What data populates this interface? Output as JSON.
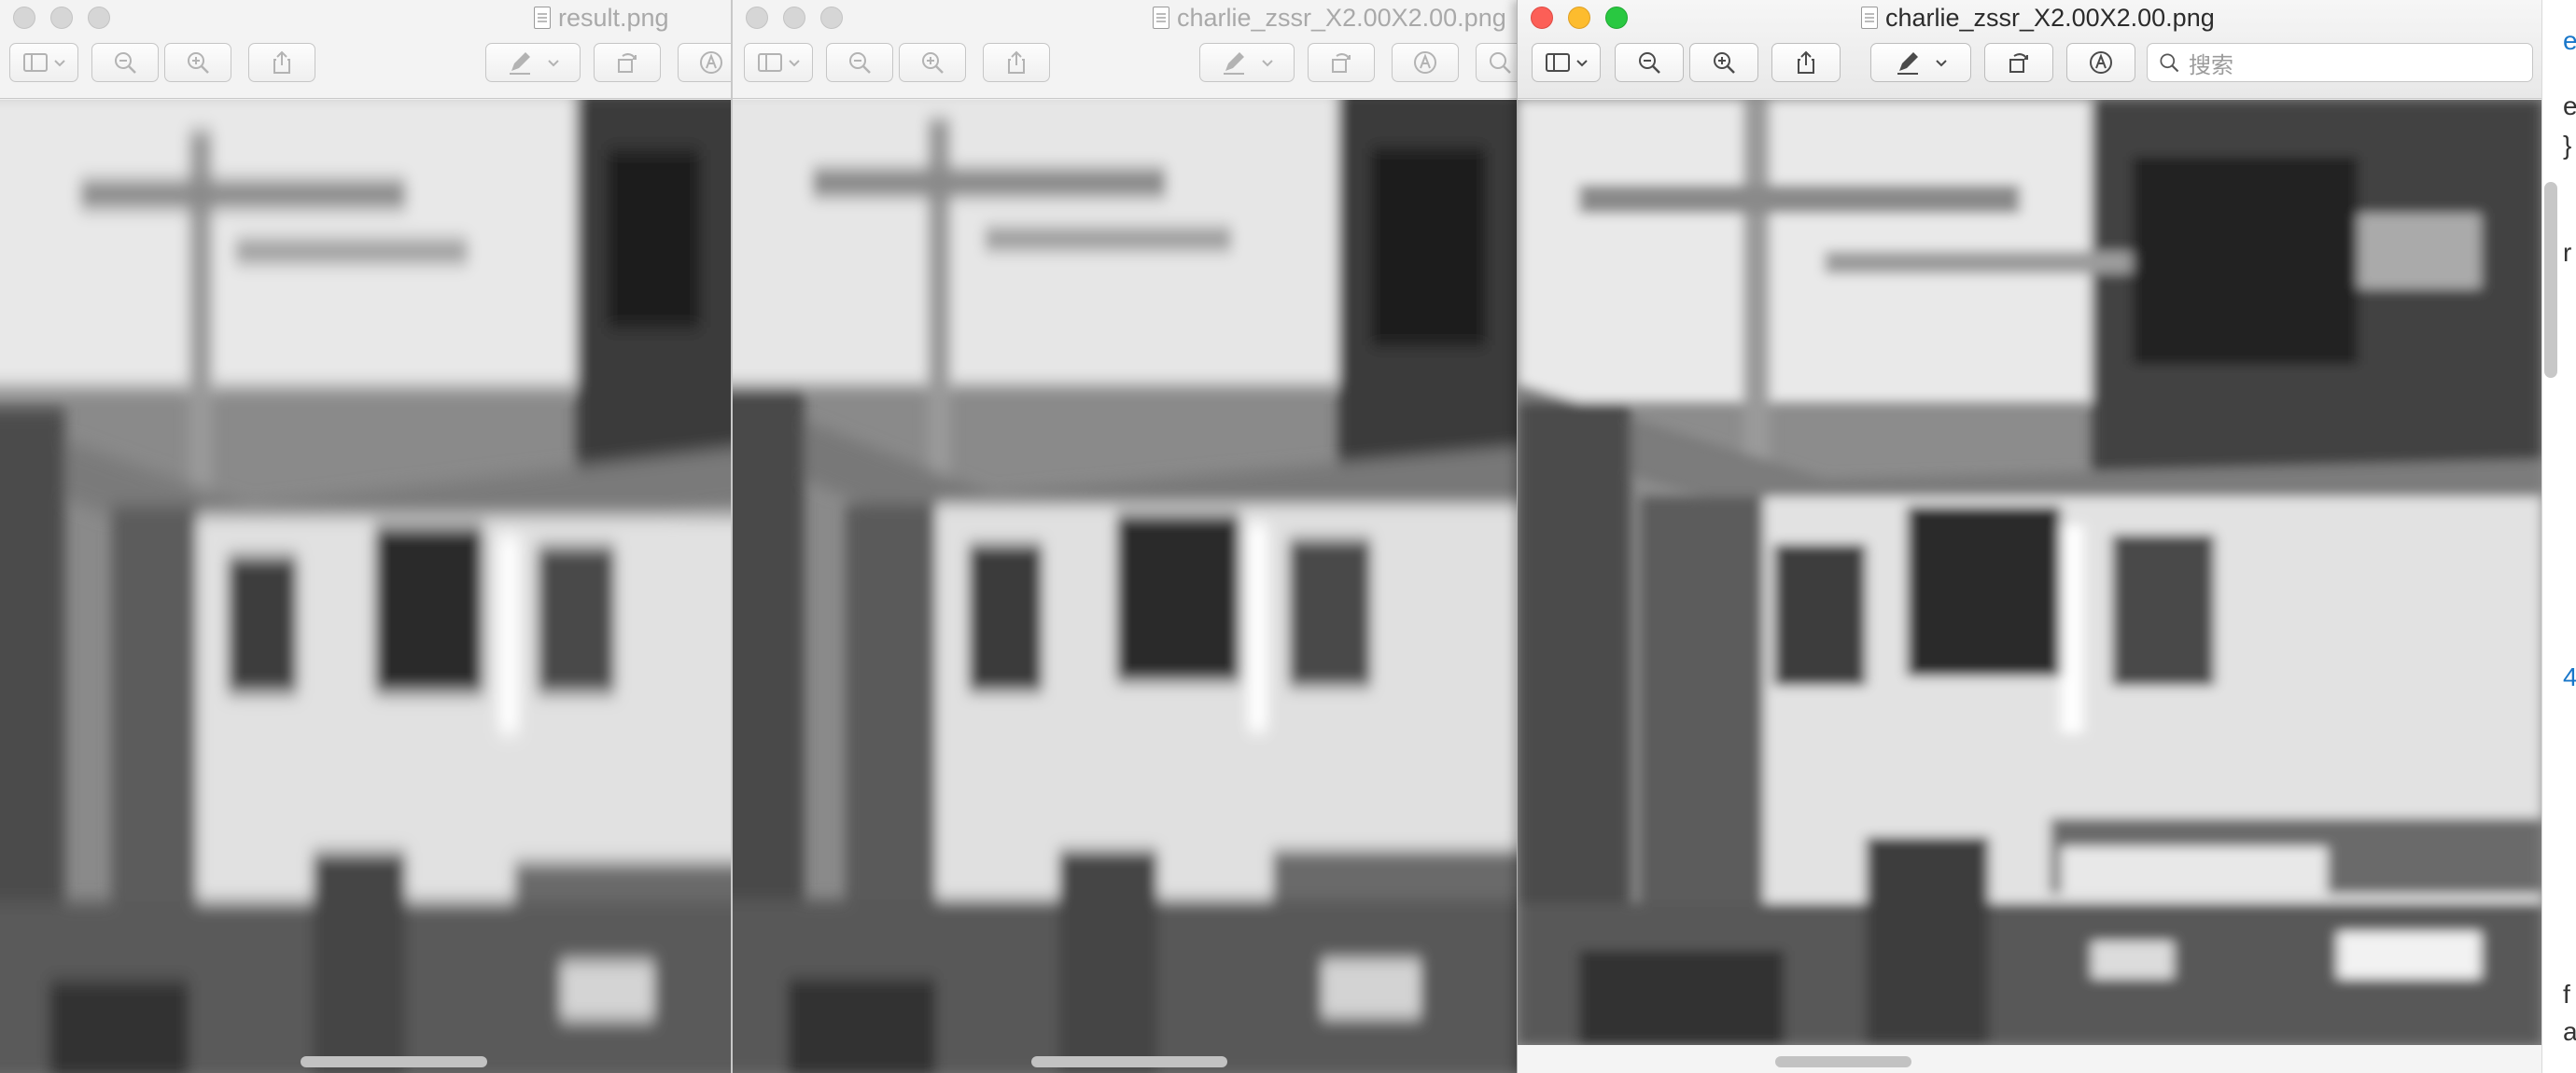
{
  "windows": [
    {
      "id": "left",
      "title": "result.png",
      "active": false
    },
    {
      "id": "middle",
      "title": "charlie_zssr_X2.00X2.00.png",
      "active": false
    },
    {
      "id": "right",
      "title": "charlie_zssr_X2.00X2.00.png",
      "active": true
    }
  ],
  "toolbar": {
    "sidebar_icon": "sidebar-icon",
    "zoom_out_icon": "zoom-out-icon",
    "zoom_in_icon": "zoom-in-icon",
    "share_icon": "share-icon",
    "markup_icon": "pen-icon",
    "rotate_icon": "rotate-icon",
    "annotate_icon": "annotate-icon",
    "search_placeholder": "搜索"
  },
  "background_text": [
    "e",
    "e",
    "}",
    "r",
    "4",
    "f",
    "a"
  ],
  "colors": {
    "close": "#fc5f57",
    "minimize": "#fdbc2e",
    "zoom": "#29c841",
    "link": "#1a77c9"
  }
}
